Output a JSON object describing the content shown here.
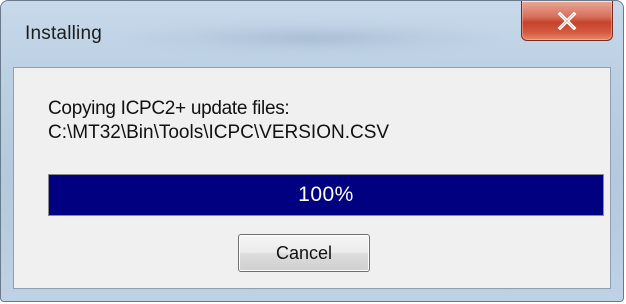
{
  "window": {
    "title": "Installing",
    "close_icon": "close-icon"
  },
  "dialog": {
    "message_line1": "Copying ICPC2+ update files:",
    "message_line2": "C:\\MT32\\Bin\\Tools\\ICPC\\VERSION.CSV"
  },
  "progress": {
    "value": 1.0,
    "label": "100%",
    "fill_color": "#000080"
  },
  "buttons": {
    "cancel_label": "Cancel"
  },
  "colors": {
    "close_button": "#c6432b",
    "titlebar": "#bcd0e4",
    "client_background": "#f0f0f0"
  }
}
